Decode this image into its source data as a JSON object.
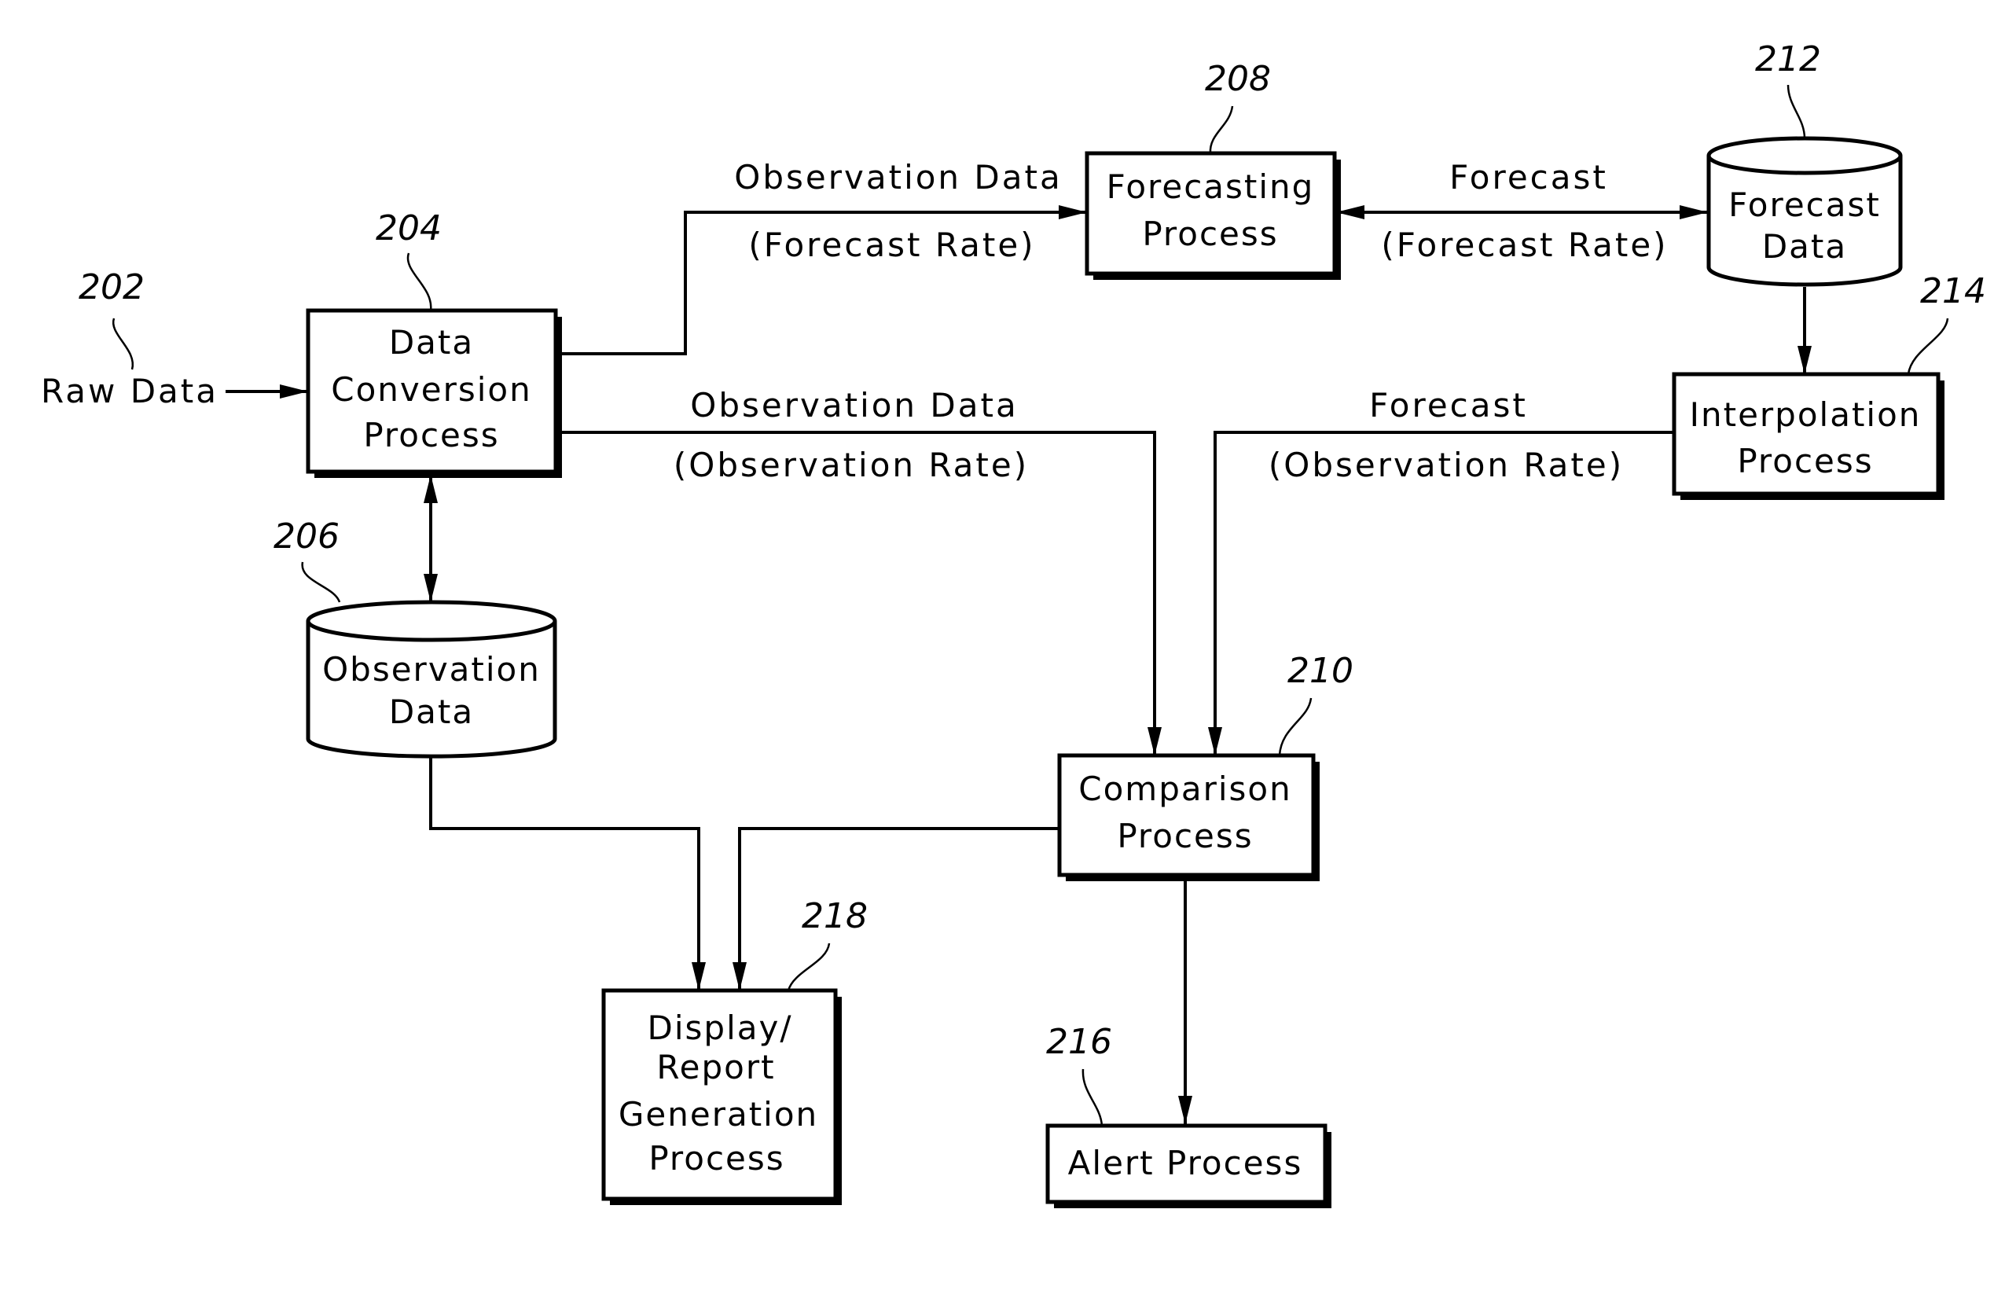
{
  "diagram": {
    "type": "flowchart",
    "nodes": [
      {
        "id": "raw",
        "ref": "202",
        "kind": "input",
        "lines": [
          "Raw  Data"
        ]
      },
      {
        "id": "conv",
        "ref": "204",
        "kind": "process",
        "lines": [
          "Data",
          "Conversion",
          "Process"
        ]
      },
      {
        "id": "obsdb",
        "ref": "206",
        "kind": "datastore",
        "lines": [
          "Observation",
          "Data"
        ]
      },
      {
        "id": "fcst",
        "ref": "208",
        "kind": "process",
        "lines": [
          "Forecasting",
          "Process"
        ]
      },
      {
        "id": "cmp",
        "ref": "210",
        "kind": "process",
        "lines": [
          "Comparison",
          "Process"
        ]
      },
      {
        "id": "fcdb",
        "ref": "212",
        "kind": "datastore",
        "lines": [
          "Forecast",
          "Data"
        ]
      },
      {
        "id": "interp",
        "ref": "214",
        "kind": "process",
        "lines": [
          "Interpolation",
          "Process"
        ]
      },
      {
        "id": "alert",
        "ref": "216",
        "kind": "process",
        "lines": [
          "Alert  Process"
        ]
      },
      {
        "id": "disp",
        "ref": "218",
        "kind": "process",
        "lines": [
          "Display/",
          "Report",
          "Generation",
          "Process"
        ]
      }
    ],
    "edges": [
      {
        "from": "raw",
        "to": "conv",
        "label": []
      },
      {
        "from": "conv",
        "to": "fcst",
        "label": [
          "Observation  Data",
          "(Forecast  Rate)"
        ]
      },
      {
        "from": "fcst",
        "to": "fcdb",
        "bidirectional": true,
        "label": [
          "Forecast",
          "(Forecast  Rate)"
        ]
      },
      {
        "from": "fcdb",
        "to": "interp",
        "label": []
      },
      {
        "from": "conv",
        "to": "cmp",
        "label": [
          "Observation  Data",
          "(Observation  Rate)"
        ]
      },
      {
        "from": "interp",
        "to": "cmp",
        "label": [
          "Forecast",
          "(Observation  Rate)"
        ]
      },
      {
        "from": "conv",
        "to": "obsdb",
        "bidirectional": true,
        "label": []
      },
      {
        "from": "obsdb",
        "to": "disp",
        "label": []
      },
      {
        "from": "cmp",
        "to": "disp",
        "label": []
      },
      {
        "from": "cmp",
        "to": "alert",
        "label": []
      }
    ]
  }
}
